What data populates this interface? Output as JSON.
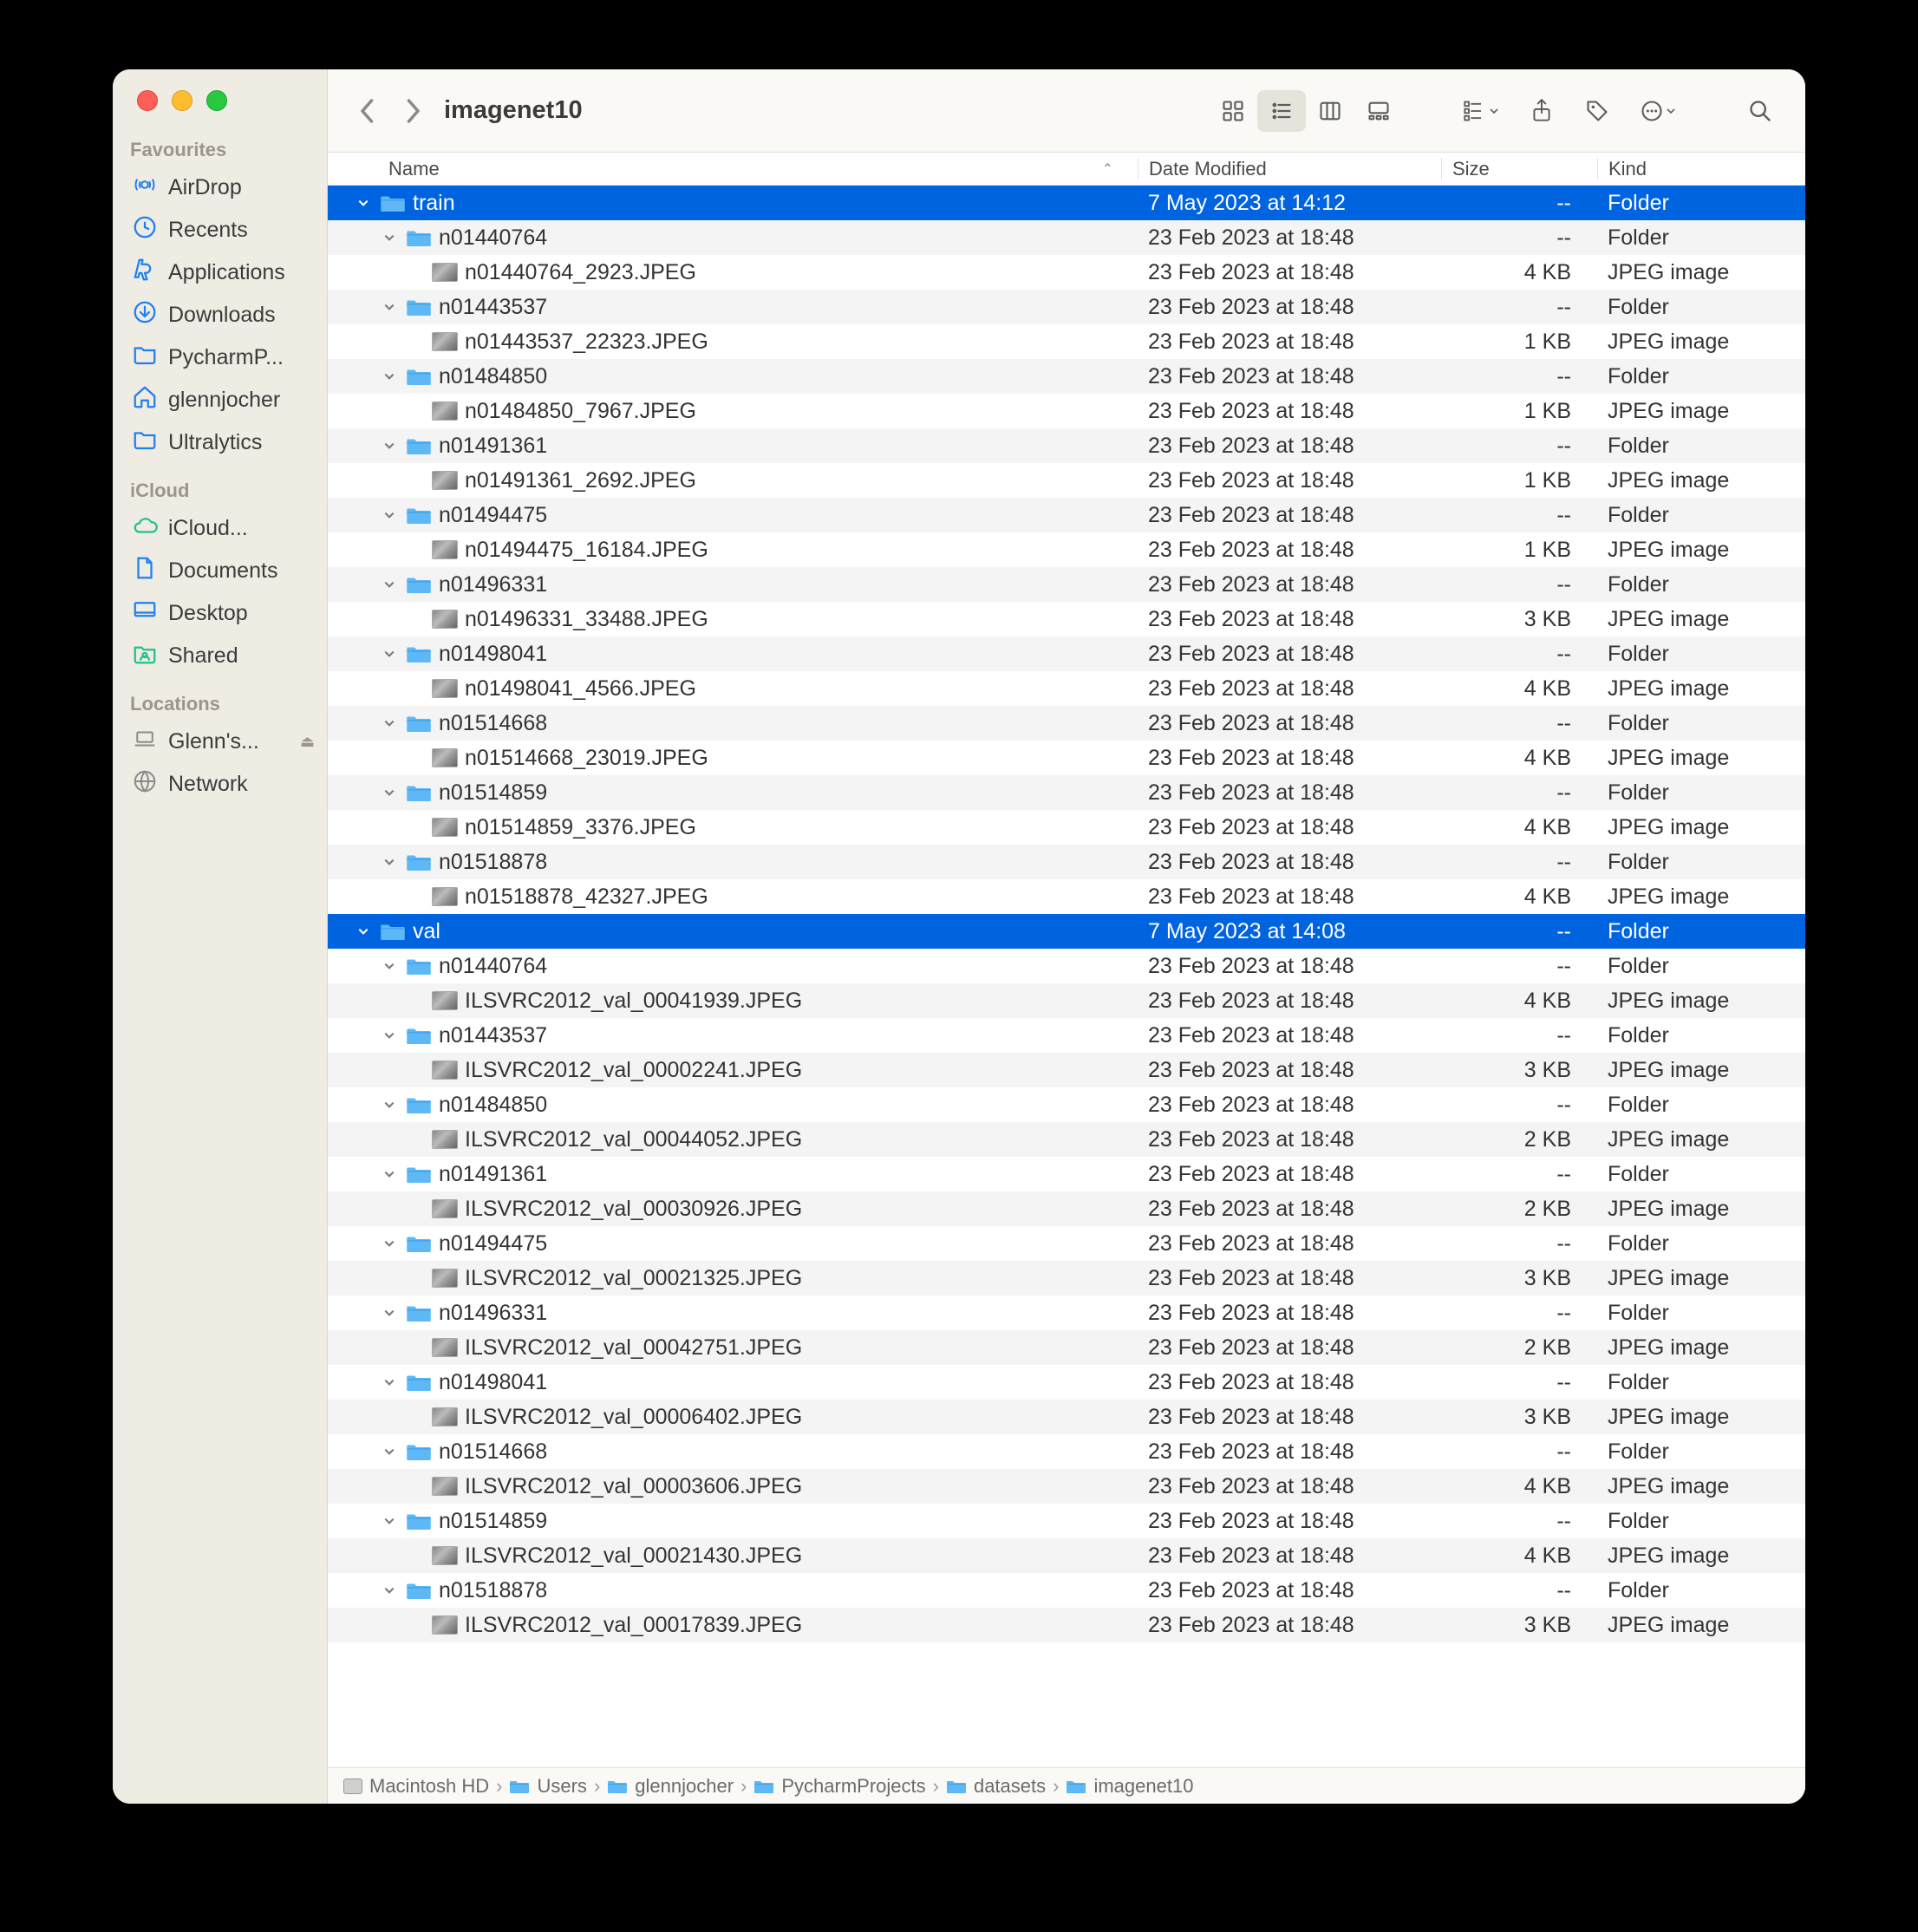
{
  "window": {
    "title": "imagenet10"
  },
  "sidebar": {
    "sections": [
      {
        "label": "Favourites",
        "items": [
          {
            "icon": "airdrop",
            "label": "AirDrop"
          },
          {
            "icon": "clock",
            "label": "Recents"
          },
          {
            "icon": "apps",
            "label": "Applications"
          },
          {
            "icon": "download",
            "label": "Downloads"
          },
          {
            "icon": "folder",
            "label": "PycharmP..."
          },
          {
            "icon": "home",
            "label": "glennjocher"
          },
          {
            "icon": "folder",
            "label": "Ultralytics"
          }
        ]
      },
      {
        "label": "iCloud",
        "items": [
          {
            "icon": "cloud",
            "label": "iCloud..."
          },
          {
            "icon": "doc",
            "label": "Documents"
          },
          {
            "icon": "desktop",
            "label": "Desktop"
          },
          {
            "icon": "shared",
            "label": "Shared"
          }
        ]
      },
      {
        "label": "Locations",
        "items": [
          {
            "icon": "laptop",
            "label": "Glenn's...",
            "eject": true
          },
          {
            "icon": "globe",
            "label": "Network"
          }
        ]
      }
    ]
  },
  "columns": {
    "name": "Name",
    "date": "Date Modified",
    "size": "Size",
    "kind": "Kind"
  },
  "rows": [
    {
      "depth": 0,
      "type": "folder",
      "expanded": true,
      "selected": true,
      "name": "train",
      "date": "7 May 2023 at 14:12",
      "size": "--",
      "kind": "Folder"
    },
    {
      "depth": 1,
      "type": "folder",
      "expanded": true,
      "name": "n01440764",
      "date": "23 Feb 2023 at 18:48",
      "size": "--",
      "kind": "Folder"
    },
    {
      "depth": 2,
      "type": "file",
      "name": "n01440764_2923.JPEG",
      "date": "23 Feb 2023 at 18:48",
      "size": "4 KB",
      "kind": "JPEG image"
    },
    {
      "depth": 1,
      "type": "folder",
      "expanded": true,
      "name": "n01443537",
      "date": "23 Feb 2023 at 18:48",
      "size": "--",
      "kind": "Folder"
    },
    {
      "depth": 2,
      "type": "file",
      "name": "n01443537_22323.JPEG",
      "date": "23 Feb 2023 at 18:48",
      "size": "1 KB",
      "kind": "JPEG image"
    },
    {
      "depth": 1,
      "type": "folder",
      "expanded": true,
      "name": "n01484850",
      "date": "23 Feb 2023 at 18:48",
      "size": "--",
      "kind": "Folder"
    },
    {
      "depth": 2,
      "type": "file",
      "name": "n01484850_7967.JPEG",
      "date": "23 Feb 2023 at 18:48",
      "size": "1 KB",
      "kind": "JPEG image"
    },
    {
      "depth": 1,
      "type": "folder",
      "expanded": true,
      "name": "n01491361",
      "date": "23 Feb 2023 at 18:48",
      "size": "--",
      "kind": "Folder"
    },
    {
      "depth": 2,
      "type": "file",
      "name": "n01491361_2692.JPEG",
      "date": "23 Feb 2023 at 18:48",
      "size": "1 KB",
      "kind": "JPEG image"
    },
    {
      "depth": 1,
      "type": "folder",
      "expanded": true,
      "name": "n01494475",
      "date": "23 Feb 2023 at 18:48",
      "size": "--",
      "kind": "Folder"
    },
    {
      "depth": 2,
      "type": "file",
      "name": "n01494475_16184.JPEG",
      "date": "23 Feb 2023 at 18:48",
      "size": "1 KB",
      "kind": "JPEG image"
    },
    {
      "depth": 1,
      "type": "folder",
      "expanded": true,
      "name": "n01496331",
      "date": "23 Feb 2023 at 18:48",
      "size": "--",
      "kind": "Folder"
    },
    {
      "depth": 2,
      "type": "file",
      "name": "n01496331_33488.JPEG",
      "date": "23 Feb 2023 at 18:48",
      "size": "3 KB",
      "kind": "JPEG image"
    },
    {
      "depth": 1,
      "type": "folder",
      "expanded": true,
      "name": "n01498041",
      "date": "23 Feb 2023 at 18:48",
      "size": "--",
      "kind": "Folder"
    },
    {
      "depth": 2,
      "type": "file",
      "name": "n01498041_4566.JPEG",
      "date": "23 Feb 2023 at 18:48",
      "size": "4 KB",
      "kind": "JPEG image"
    },
    {
      "depth": 1,
      "type": "folder",
      "expanded": true,
      "name": "n01514668",
      "date": "23 Feb 2023 at 18:48",
      "size": "--",
      "kind": "Folder"
    },
    {
      "depth": 2,
      "type": "file",
      "name": "n01514668_23019.JPEG",
      "date": "23 Feb 2023 at 18:48",
      "size": "4 KB",
      "kind": "JPEG image"
    },
    {
      "depth": 1,
      "type": "folder",
      "expanded": true,
      "name": "n01514859",
      "date": "23 Feb 2023 at 18:48",
      "size": "--",
      "kind": "Folder"
    },
    {
      "depth": 2,
      "type": "file",
      "name": "n01514859_3376.JPEG",
      "date": "23 Feb 2023 at 18:48",
      "size": "4 KB",
      "kind": "JPEG image"
    },
    {
      "depth": 1,
      "type": "folder",
      "expanded": true,
      "name": "n01518878",
      "date": "23 Feb 2023 at 18:48",
      "size": "--",
      "kind": "Folder"
    },
    {
      "depth": 2,
      "type": "file",
      "name": "n01518878_42327.JPEG",
      "date": "23 Feb 2023 at 18:48",
      "size": "4 KB",
      "kind": "JPEG image"
    },
    {
      "depth": 0,
      "type": "folder",
      "expanded": true,
      "selected": true,
      "name": "val",
      "date": "7 May 2023 at 14:08",
      "size": "--",
      "kind": "Folder"
    },
    {
      "depth": 1,
      "type": "folder",
      "expanded": true,
      "name": "n01440764",
      "date": "23 Feb 2023 at 18:48",
      "size": "--",
      "kind": "Folder"
    },
    {
      "depth": 2,
      "type": "file",
      "name": "ILSVRC2012_val_00041939.JPEG",
      "date": "23 Feb 2023 at 18:48",
      "size": "4 KB",
      "kind": "JPEG image"
    },
    {
      "depth": 1,
      "type": "folder",
      "expanded": true,
      "name": "n01443537",
      "date": "23 Feb 2023 at 18:48",
      "size": "--",
      "kind": "Folder"
    },
    {
      "depth": 2,
      "type": "file",
      "name": "ILSVRC2012_val_00002241.JPEG",
      "date": "23 Feb 2023 at 18:48",
      "size": "3 KB",
      "kind": "JPEG image"
    },
    {
      "depth": 1,
      "type": "folder",
      "expanded": true,
      "name": "n01484850",
      "date": "23 Feb 2023 at 18:48",
      "size": "--",
      "kind": "Folder"
    },
    {
      "depth": 2,
      "type": "file",
      "name": "ILSVRC2012_val_00044052.JPEG",
      "date": "23 Feb 2023 at 18:48",
      "size": "2 KB",
      "kind": "JPEG image"
    },
    {
      "depth": 1,
      "type": "folder",
      "expanded": true,
      "name": "n01491361",
      "date": "23 Feb 2023 at 18:48",
      "size": "--",
      "kind": "Folder"
    },
    {
      "depth": 2,
      "type": "file",
      "name": "ILSVRC2012_val_00030926.JPEG",
      "date": "23 Feb 2023 at 18:48",
      "size": "2 KB",
      "kind": "JPEG image"
    },
    {
      "depth": 1,
      "type": "folder",
      "expanded": true,
      "name": "n01494475",
      "date": "23 Feb 2023 at 18:48",
      "size": "--",
      "kind": "Folder"
    },
    {
      "depth": 2,
      "type": "file",
      "name": "ILSVRC2012_val_00021325.JPEG",
      "date": "23 Feb 2023 at 18:48",
      "size": "3 KB",
      "kind": "JPEG image"
    },
    {
      "depth": 1,
      "type": "folder",
      "expanded": true,
      "name": "n01496331",
      "date": "23 Feb 2023 at 18:48",
      "size": "--",
      "kind": "Folder"
    },
    {
      "depth": 2,
      "type": "file",
      "name": "ILSVRC2012_val_00042751.JPEG",
      "date": "23 Feb 2023 at 18:48",
      "size": "2 KB",
      "kind": "JPEG image"
    },
    {
      "depth": 1,
      "type": "folder",
      "expanded": true,
      "name": "n01498041",
      "date": "23 Feb 2023 at 18:48",
      "size": "--",
      "kind": "Folder"
    },
    {
      "depth": 2,
      "type": "file",
      "name": "ILSVRC2012_val_00006402.JPEG",
      "date": "23 Feb 2023 at 18:48",
      "size": "3 KB",
      "kind": "JPEG image"
    },
    {
      "depth": 1,
      "type": "folder",
      "expanded": true,
      "name": "n01514668",
      "date": "23 Feb 2023 at 18:48",
      "size": "--",
      "kind": "Folder"
    },
    {
      "depth": 2,
      "type": "file",
      "name": "ILSVRC2012_val_00003606.JPEG",
      "date": "23 Feb 2023 at 18:48",
      "size": "4 KB",
      "kind": "JPEG image"
    },
    {
      "depth": 1,
      "type": "folder",
      "expanded": true,
      "name": "n01514859",
      "date": "23 Feb 2023 at 18:48",
      "size": "--",
      "kind": "Folder"
    },
    {
      "depth": 2,
      "type": "file",
      "name": "ILSVRC2012_val_00021430.JPEG",
      "date": "23 Feb 2023 at 18:48",
      "size": "4 KB",
      "kind": "JPEG image"
    },
    {
      "depth": 1,
      "type": "folder",
      "expanded": true,
      "name": "n01518878",
      "date": "23 Feb 2023 at 18:48",
      "size": "--",
      "kind": "Folder"
    },
    {
      "depth": 2,
      "type": "file",
      "name": "ILSVRC2012_val_00017839.JPEG",
      "date": "23 Feb 2023 at 18:48",
      "size": "3 KB",
      "kind": "JPEG image"
    }
  ],
  "path": [
    "Macintosh HD",
    "Users",
    "glennjocher",
    "PycharmProjects",
    "datasets",
    "imagenet10"
  ]
}
